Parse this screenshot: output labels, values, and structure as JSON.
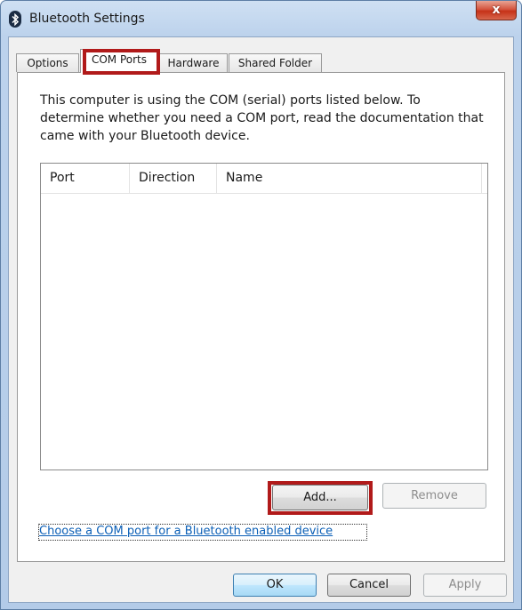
{
  "window": {
    "title": "Bluetooth Settings",
    "close_label": "x"
  },
  "tabs": [
    {
      "label": "Options"
    },
    {
      "label": "COM Ports"
    },
    {
      "label": "Hardware"
    },
    {
      "label": "Shared Folder"
    }
  ],
  "description": "This computer is using the COM (serial) ports listed below. To determine whether you need a COM port, read the documentation that came with your Bluetooth device.",
  "list": {
    "columns": [
      "Port",
      "Direction",
      "Name"
    ]
  },
  "actions": {
    "add_label": "Add...",
    "remove_label": "Remove",
    "link_text": "Choose a COM port for a Bluetooth enabled device"
  },
  "footer": {
    "ok_label": "OK",
    "cancel_label": "Cancel",
    "apply_label": "Apply"
  },
  "colors": {
    "highlight": "#b11a1a",
    "link": "#0b5fb6"
  },
  "icons": [
    "bluetooth-icon",
    "close-icon"
  ]
}
